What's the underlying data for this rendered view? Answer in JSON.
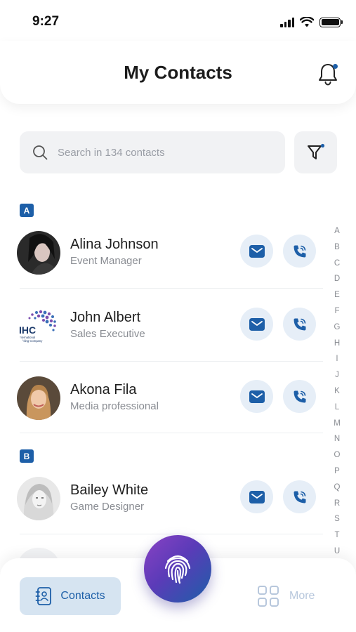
{
  "status_bar": {
    "time": "9:27"
  },
  "header": {
    "title": "My Contacts"
  },
  "search": {
    "placeholder": "Search in 134 contacts",
    "value": ""
  },
  "sections": [
    {
      "letter": "A",
      "contacts": [
        {
          "name": "Alina Johnson",
          "role": "Event Manager"
        },
        {
          "name": "John Albert",
          "role": "Sales Executive",
          "avatar_logo_text": "IHC",
          "avatar_logo_subtext": "International Holding Company"
        },
        {
          "name": "Akona Fila",
          "role": "Media professional"
        }
      ]
    },
    {
      "letter": "B",
      "contacts": [
        {
          "name": "Bailey White",
          "role": "Game Designer"
        }
      ]
    }
  ],
  "alphabet_index": [
    "A",
    "B",
    "C",
    "D",
    "E",
    "F",
    "G",
    "H",
    "I",
    "J",
    "K",
    "L",
    "M",
    "N",
    "O",
    "P",
    "Q",
    "R",
    "S",
    "T",
    "U"
  ],
  "bottom_nav": {
    "contacts_label": "Contacts",
    "more_label": "More"
  },
  "colors": {
    "accent": "#1d5fa8",
    "action_bg": "#e6eef7",
    "tab_active_bg": "#d6e4f1",
    "more_inactive": "#b7c7dc"
  },
  "icons": [
    "bell-icon",
    "search-icon",
    "filter-icon",
    "mail-icon",
    "phone-icon",
    "contacts-book-icon",
    "grid-icon",
    "fingerprint-icon"
  ]
}
